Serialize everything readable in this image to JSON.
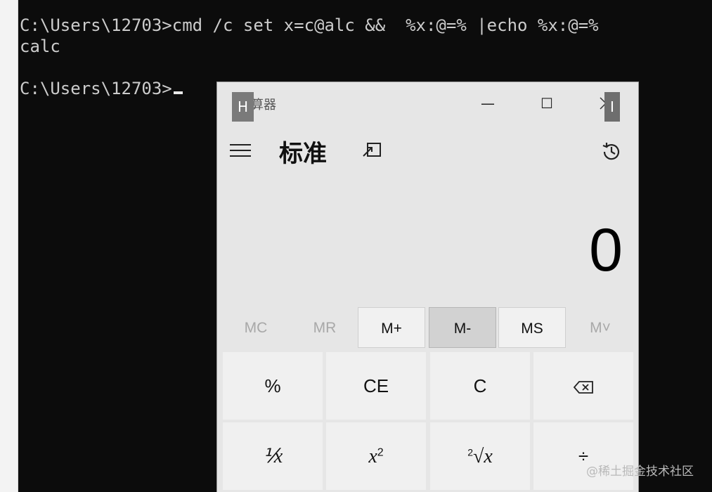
{
  "console": {
    "line1": "C:\\Users\\12703>cmd /c set x=c@alc &&  %x:@=% |echo %x:@=%",
    "line2": "calc",
    "prompt": "C:\\Users\\12703>"
  },
  "calculator": {
    "window_title": "算器",
    "badge_h": "H",
    "badge_i": "I",
    "min_icon": "—",
    "max_icon": "☐",
    "mode": "标准",
    "display_value": "0",
    "memory": [
      "MC",
      "MR",
      "M+",
      "M-",
      "MS",
      "M˅"
    ],
    "keys": {
      "percent": "%",
      "ce": "CE",
      "c": "C",
      "reciprocal": "⅟x",
      "square_base": "x",
      "square_exp": "2",
      "sqrt_index": "2",
      "sqrt_symbol": "√x",
      "divide": "÷"
    }
  },
  "watermark": "@稀土掘金技术社区"
}
